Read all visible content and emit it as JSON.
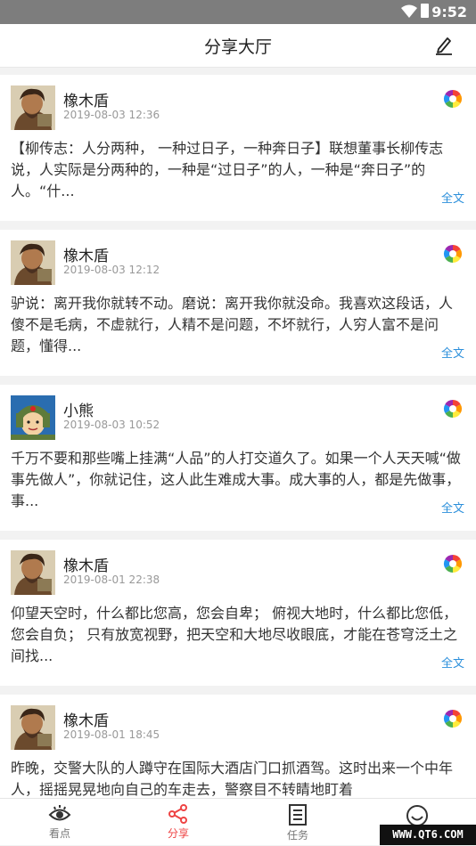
{
  "status": {
    "time": "9:52"
  },
  "header": {
    "title": "分享大厅"
  },
  "posts": [
    {
      "author": "橡木盾",
      "time": "2019-08-03 12:36",
      "text": "【柳传志：人分两种， 一种过日子，一种奔日子】联想董事长柳传志说，人实际是分两种的，一种是“过日子”的人，一种是“奔日子”的人。“什...",
      "more": "全文",
      "avatar": "bearded-man-avatar"
    },
    {
      "author": "橡木盾",
      "time": "2019-08-03 12:12",
      "text": "驴说：离开我你就转不动。磨说：离开我你就没命。我喜欢这段话，人傻不是毛病，不虚就行，人精不是问题，不坏就行，人穷人富不是问题，懂得...",
      "more": "全文",
      "avatar": "bearded-man-avatar"
    },
    {
      "author": "小熊",
      "time": "2019-08-03 10:52",
      "text": "千万不要和那些嘴上挂满“人品”的人打交道久了。如果一个人天天喊“做事先做人”，你就记住，这人此生难成大事。成大事的人，都是先做事，事...",
      "more": "全文",
      "avatar": "cartoon-soldier-avatar"
    },
    {
      "author": "橡木盾",
      "time": "2019-08-01 22:38",
      "text": "仰望天空时，什么都比您高，您会自卑； 俯视大地时，什么都比您低，您会自负； 只有放宽视野，把天空和大地尽收眼底，才能在苍穹泛土之间找...",
      "more": "全文",
      "avatar": "bearded-man-avatar"
    },
    {
      "author": "橡木盾",
      "time": "2019-08-01 18:45",
      "text": "昨晚，交警大队的人蹲守在国际大酒店门口抓酒驾。这时出来一个中年人，摇摇晃晃地向自己的车走去，警察目不转睛地盯着",
      "more": "",
      "avatar": "bearded-man-avatar"
    }
  ],
  "tabs": [
    {
      "label": "看点",
      "icon": "eye-icon"
    },
    {
      "label": "分享",
      "icon": "share-icon"
    },
    {
      "label": "任务",
      "icon": "task-list-icon"
    },
    {
      "label": "",
      "icon": "smiley-icon"
    }
  ],
  "watermark": "WWW.QT6.COM",
  "colors": {
    "accent": "#e44444",
    "link": "#2b8fdb"
  }
}
